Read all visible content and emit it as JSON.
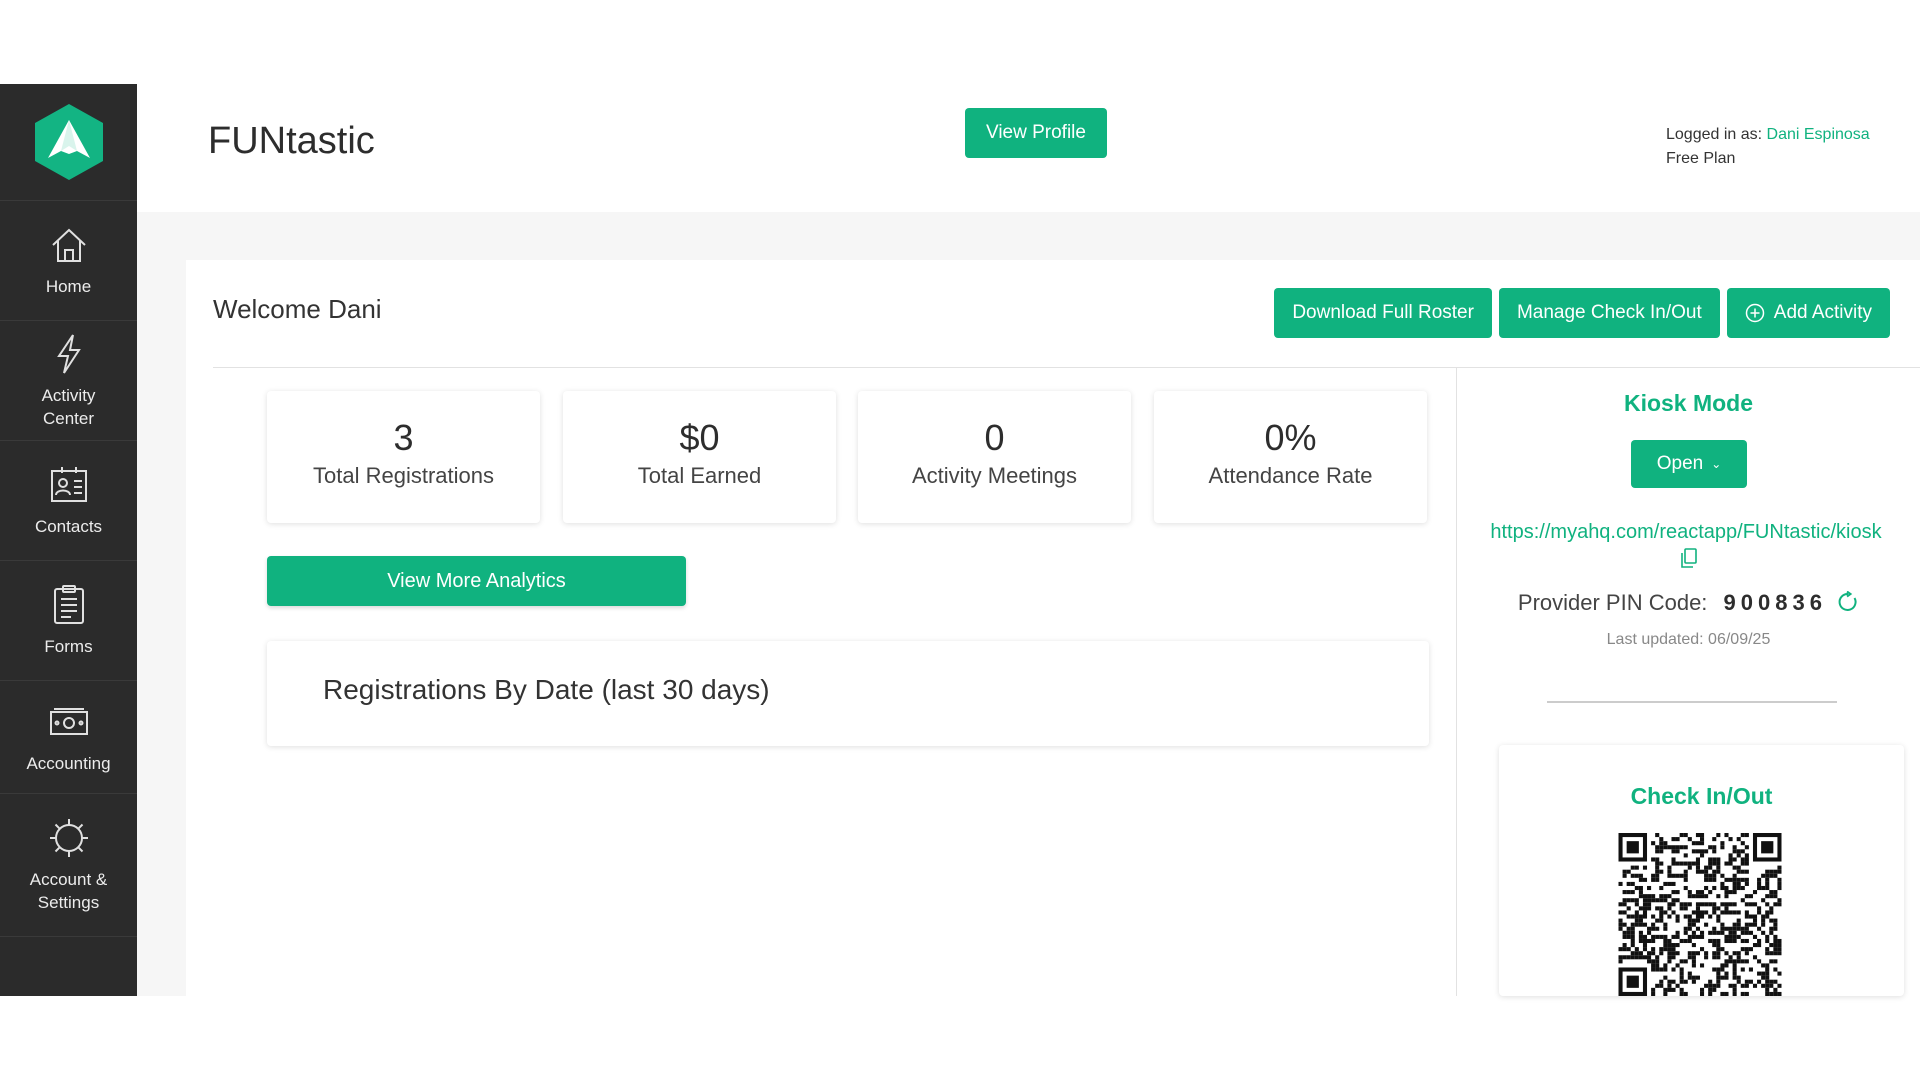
{
  "header": {
    "org_name": "FUNtastic",
    "view_profile_label": "View Profile",
    "logged_in_label": "Logged in as:",
    "user_name": "Dani Espinosa",
    "plan": "Free Plan"
  },
  "sidebar": {
    "items": [
      {
        "label": "Home",
        "icon": "home-icon"
      },
      {
        "label": "Activity Center",
        "icon": "lightning-icon"
      },
      {
        "label": "Contacts",
        "icon": "contacts-icon"
      },
      {
        "label": "Forms",
        "icon": "forms-icon"
      },
      {
        "label": "Accounting",
        "icon": "money-icon"
      },
      {
        "label": "Account & Settings",
        "icon": "gear-icon"
      }
    ]
  },
  "dashboard": {
    "welcome": "Welcome Dani",
    "actions": {
      "download_roster": "Download Full Roster",
      "manage_check": "Manage Check In/Out",
      "add_activity": "Add Activity"
    },
    "stats": [
      {
        "value": "3",
        "label": "Total Registrations"
      },
      {
        "value": "$0",
        "label": "Total Earned"
      },
      {
        "value": "0",
        "label": "Activity Meetings"
      },
      {
        "value": "0%",
        "label": "Attendance Rate"
      }
    ],
    "analytics_button": "View More Analytics",
    "registrations_title": "Registrations By Date (last 30 days)"
  },
  "kiosk": {
    "title": "Kiosk Mode",
    "open_label": "Open",
    "url": "https://myahq.com/reactapp/FUNtastic/kiosk",
    "pin_label": "Provider PIN Code:",
    "pin_code": "900836",
    "last_updated": "Last updated: 06/09/25"
  },
  "checkin": {
    "title": "Check In/Out"
  },
  "colors": {
    "accent": "#10b27f",
    "sidebar": "#2b2b2b"
  }
}
